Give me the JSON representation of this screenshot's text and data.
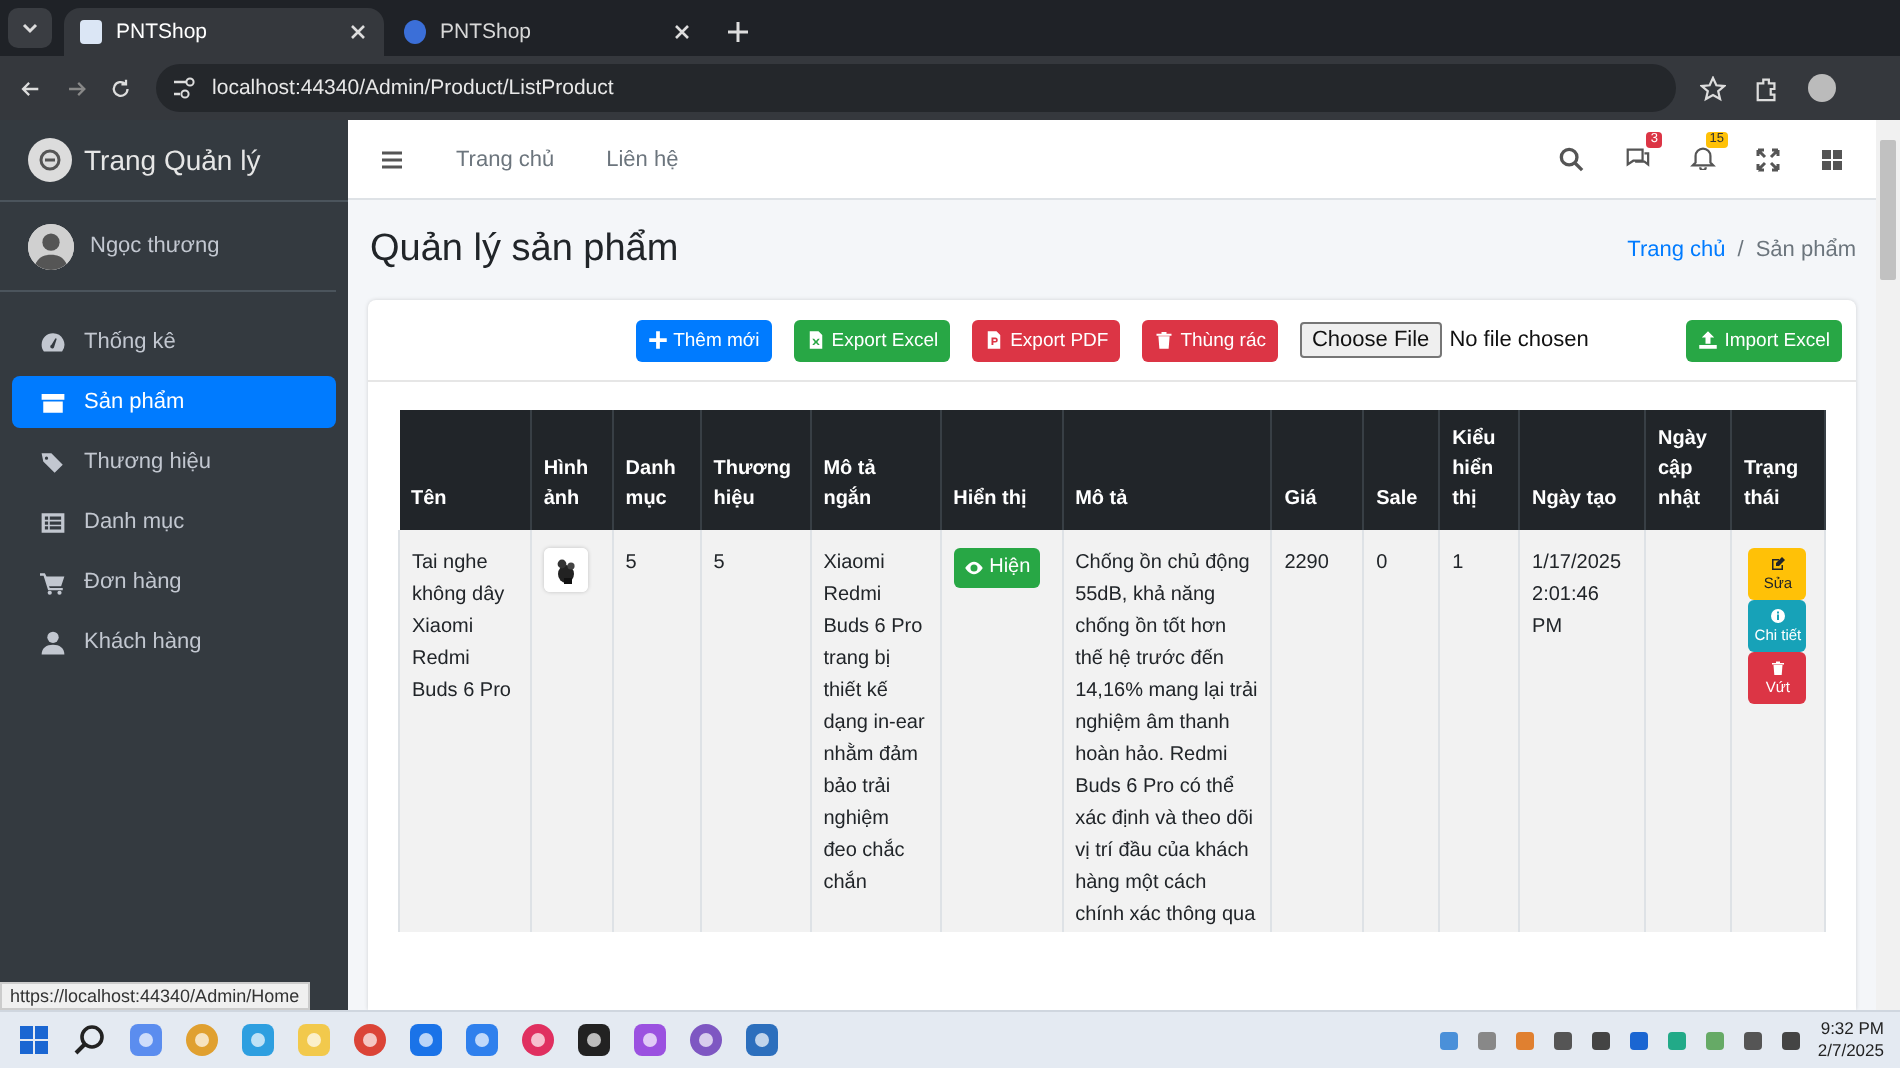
{
  "browser": {
    "tabs": [
      {
        "title": "PNTShop",
        "selected": true
      },
      {
        "title": "PNTShop",
        "selected": false
      }
    ],
    "address": "localhost:44340/Admin/Product/ListProduct"
  },
  "sidebar": {
    "brand": "Trang Quản lý",
    "user": "Ngọc thương",
    "items": [
      {
        "label": "Thống kê",
        "selected": false
      },
      {
        "label": "Sản phẩm",
        "selected": true
      },
      {
        "label": "Thương hiệu",
        "selected": false
      },
      {
        "label": "Danh mục",
        "selected": false
      },
      {
        "label": "Đơn hàng",
        "selected": false
      },
      {
        "label": "Khách hàng",
        "selected": false
      }
    ]
  },
  "navbar": {
    "links": [
      "Trang chủ",
      "Liên hệ"
    ],
    "message_count": "3",
    "notification_count": "15"
  },
  "page": {
    "title": "Quản lý sản phẩm",
    "breadcrumb": [
      "Trang chủ",
      "Sản phẩm"
    ],
    "breadcrumb_separator": "/"
  },
  "toolbar": {
    "buttons": [
      "Thêm mới",
      "Export Excel",
      "Export PDF",
      "Thùng rác"
    ],
    "file_input": {
      "button": "Choose File",
      "status": "No file chosen"
    },
    "import_button": "Import Excel"
  },
  "table": {
    "columns": [
      "Tên",
      "Hình ảnh",
      "Danh mục",
      "Thương hiệu",
      "Mô tả ngắn",
      "Hiển thị",
      "Mô tả",
      "Giá",
      "Sale",
      "Kiểu hiển thị",
      "Ngày tạo",
      "Ngày cập nhật",
      "Trạng thái"
    ],
    "rows": [
      {
        "name": "Tai nghe không dây Xiaomi Redmi Buds 6 Pro",
        "image": {
          "kind": "picture"
        },
        "category": "5",
        "brand": "5",
        "short_description": "Xiaomi Redmi Buds 6 Pro trang bị thiết kế dạng in-ear nhằm đảm bảo trải nghiệm đeo chắc chắn",
        "display": {
          "label": "Hiện",
          "visible": true
        },
        "description": "Chống ồn chủ động 55dB, khả năng chống ồn tốt hơn thế hệ trước đến 14,16% mang lại trải nghiệm âm thanh hoàn hảo. Redmi Buds 6 Pro có thể xác định và theo dõi vị trí đầu của khách hàng một cách chính xác thông qua",
        "price": "2290",
        "sale": "0",
        "display_type": "1",
        "created": "1/17/2025 2:01:46 PM",
        "actions": [
          "Sửa",
          "Chi tiết",
          "Vứt"
        ]
      }
    ]
  },
  "status_url": "https://localhost:44340/Admin/Home",
  "taskbar": {
    "time": "9:32 PM",
    "date": "2/7/2025"
  }
}
